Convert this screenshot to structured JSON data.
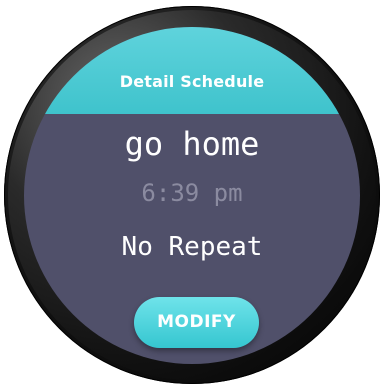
{
  "header": {
    "title": "Detail Schedule"
  },
  "schedule": {
    "name": "go home",
    "time": "6:39 pm",
    "repeat": "No Repeat"
  },
  "actions": {
    "modify_label": "MODIFY"
  },
  "colors": {
    "accent": "#3fc3cc",
    "screen_background": "#50506a",
    "time_text": "#8b8ba0"
  }
}
